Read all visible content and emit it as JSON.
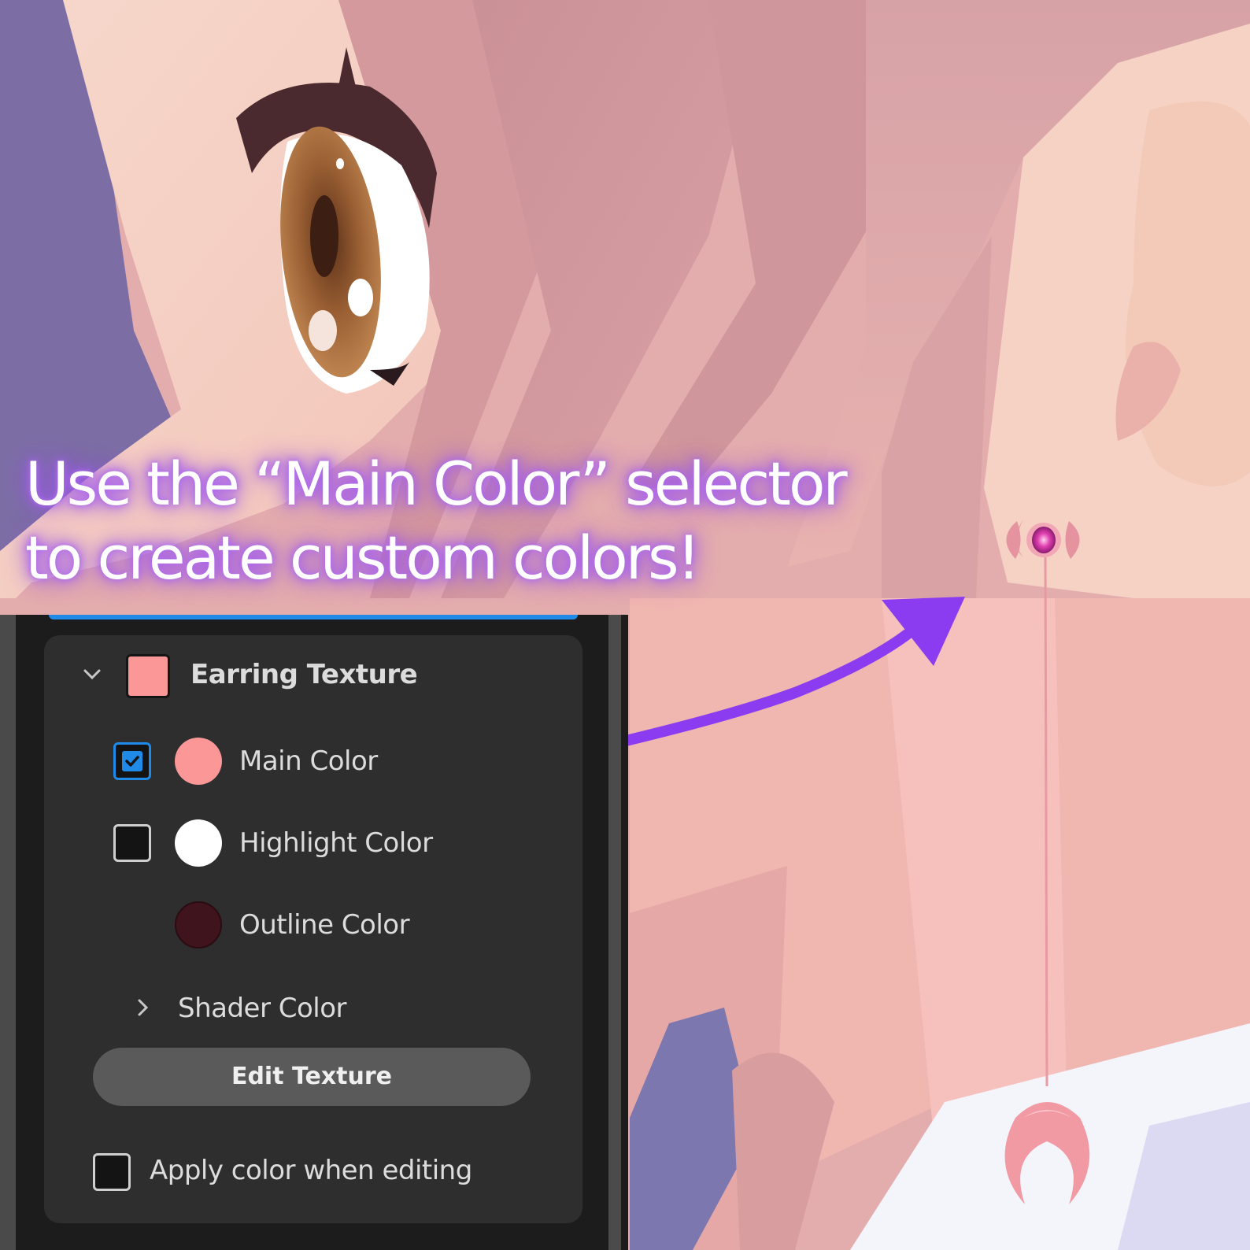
{
  "caption": {
    "line1": "Use the “Main Color” selector",
    "line2": "to create custom colors!"
  },
  "panel": {
    "section": {
      "title": "Earring Texture",
      "swatch_color": "#fb9797",
      "expanded": true
    },
    "rows": [
      {
        "label": "Main Color",
        "color": "#fb9797",
        "checkbox": true,
        "checked": true
      },
      {
        "label": "Highlight Color",
        "color": "#ffffff",
        "checkbox": true,
        "checked": false
      },
      {
        "label": "Outline Color",
        "color": "#3f141d",
        "checkbox": false,
        "checked": false
      }
    ],
    "subsection": {
      "label": "Shader Color",
      "expanded": false
    },
    "edit_button": "Edit Texture",
    "apply_checkbox": {
      "label": "Apply color when editing",
      "checked": false
    }
  },
  "colors": {
    "accent_blue": "#1f8ae8",
    "arrow_purple": "#8b3cf0",
    "caption_glow": "#a860ef"
  },
  "icons": [
    "chevron-down-icon",
    "chevron-right-icon",
    "checkmark-icon",
    "arrow-icon",
    "earring-charm"
  ]
}
